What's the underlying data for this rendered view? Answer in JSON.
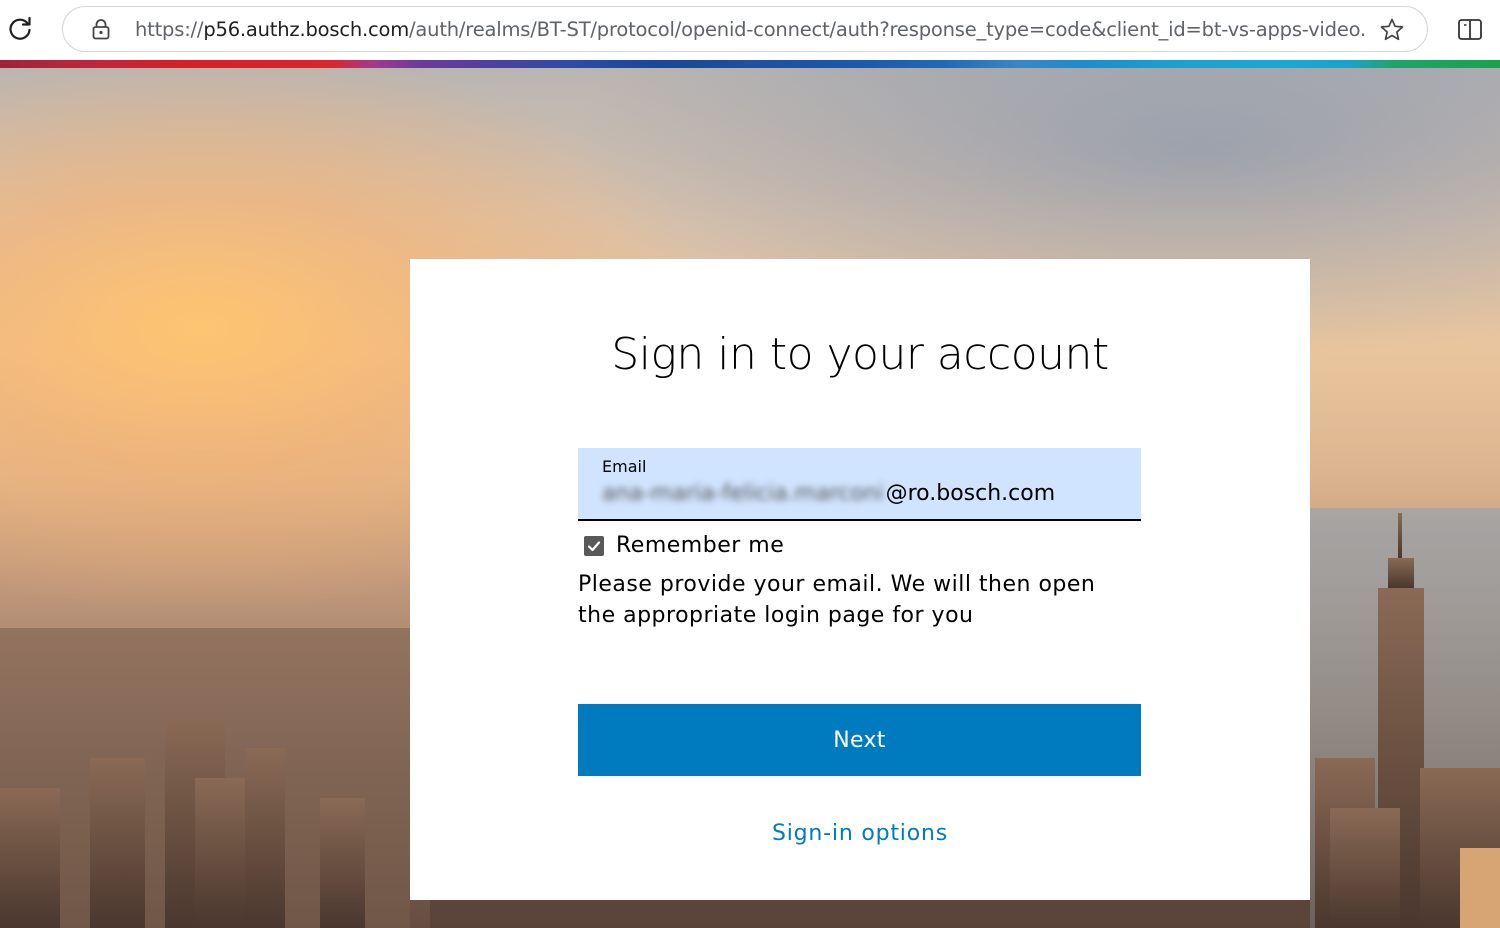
{
  "browser": {
    "url_prefix": "https://",
    "url_host": "p56.authz.bosch.com",
    "url_rest": "/auth/realms/BT-ST/protocol/openid-connect/auth?response_type=code&client_id=bt-vs-apps-video..."
  },
  "login": {
    "title": "Sign in to your account",
    "email_label": "Email",
    "email_local_part_redacted": "ana-maria-felicia.marconi",
    "email_domain": "@ro.bosch.com",
    "remember_label": "Remember me",
    "remember_checked": true,
    "help_text": "Please provide your email. We will then open the appropriate login page for you",
    "next_label": "Next",
    "signin_options_label": "Sign-in options"
  },
  "colors": {
    "primary": "#007bc0",
    "field_bg": "#d1e4ff"
  },
  "icons": {
    "reload": "reload-icon",
    "lock": "lock-icon",
    "star": "star-icon",
    "split_screen": "split-screen-icon",
    "checkbox": "checkmark-icon"
  }
}
